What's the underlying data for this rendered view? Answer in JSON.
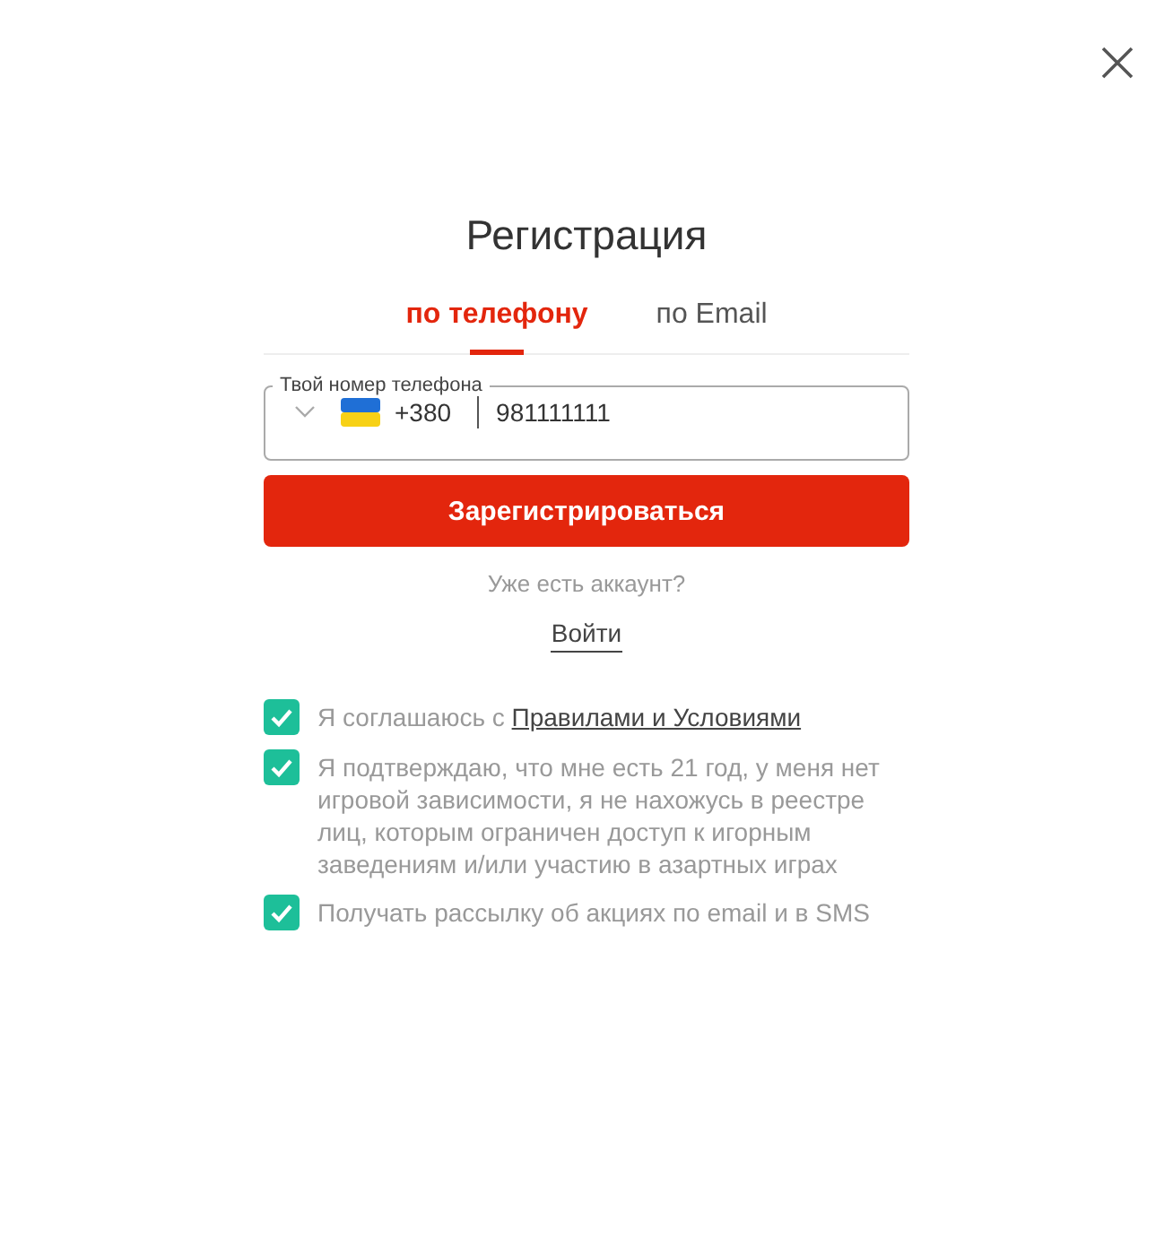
{
  "title": "Регистрация",
  "tabs": [
    {
      "label": "по телефону",
      "selected": true
    },
    {
      "label": "по Email",
      "selected": false
    }
  ],
  "phone_field": {
    "label": "Твой номер телефона",
    "country_code": "+380",
    "value": "981111111"
  },
  "submit_button": "Зарегистрироваться",
  "account_prompt": "Уже есть аккаунт?",
  "login_link": "Войти",
  "consents": [
    {
      "text": "Я соглашаюсь с ",
      "link": "Правилами и Условиями",
      "checked": true
    },
    {
      "text": "Я подтверждаю, что мне есть 21 год, у меня нет игровой зависимости, я не нахожусь в реестре лиц, которым ограничен доступ к игорным заведениям и/или участию в азартных играх",
      "checked": true
    },
    {
      "text": "Получать рассылку об акциях по email и в SMS",
      "checked": true
    }
  ]
}
